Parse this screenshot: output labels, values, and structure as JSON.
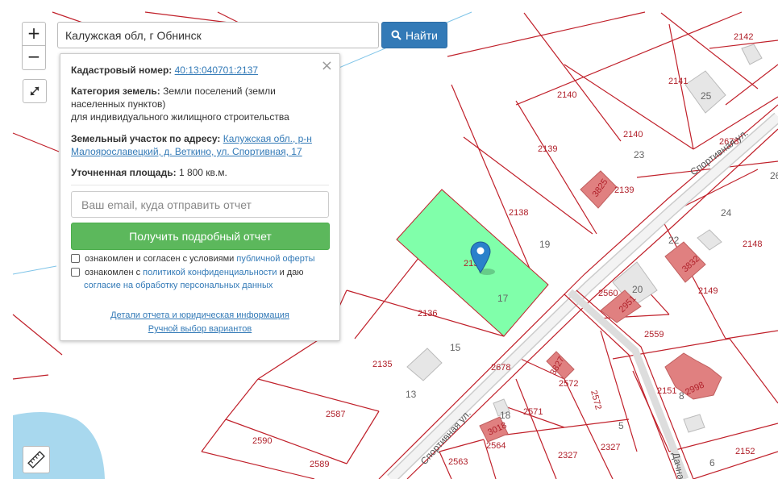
{
  "search": {
    "value": "Калужская обл, г Обнинск",
    "button_label": "Найти"
  },
  "zoom": {
    "in_label": "+",
    "out_label": "−"
  },
  "popup": {
    "close": "×",
    "cadastral_label": "Кадастровый номер:",
    "cadastral_number": "40:13:040701:2137",
    "category_label": "Категория земель:",
    "category_value_1": "Земли поселений (земли",
    "category_value_2": "населенных пунктов)",
    "category_value_3": "для индивидуального жилищного строительства",
    "address_label": "Земельный участок по адресу:",
    "address_part_1": "Калужская обл., р-н",
    "address_part_2": "Малоярославецкий, д. Веткино, ул. Спортивная, 17",
    "area_label": "Уточненная площадь:",
    "area_value": "1 800 кв.м.",
    "email_placeholder": "Ваш email, куда отправить отчет",
    "report_button": "Получить подробный отчет",
    "consent1_text": "ознакомлен и согласен с условиями",
    "consent1_link": "публичной оферты",
    "consent2_text": "ознакомлен с",
    "consent2_link1": "политикой конфиденциальности",
    "consent2_mid": "и даю",
    "consent2_link2": "согласие на обработку персональных данных",
    "details_link": "Детали отчета и юридическая информация",
    "manual_link": "Ручной выбор вариантов"
  },
  "map": {
    "selected_parcel_color": "#80ffaa",
    "parcel_border_color": "#c0202a",
    "building_color": "#e08080",
    "water_color": "#a8d8ee",
    "parcel_labels": {
      "p2142": "2142",
      "p2141": "2141",
      "p2140a": "2140",
      "p2140b": "2140",
      "p2139a": "2139",
      "p2139b": "2139",
      "p2138": "2138",
      "p2137": "2137",
      "p2136": "2136",
      "p2135": "2135",
      "p2678a": "2678",
      "p2678b": "2678",
      "p2148": "2148",
      "p2149": "2149",
      "p2560": "2560",
      "p2559": "2559",
      "p2572a": "2572",
      "p2572b": "2572",
      "p2571": "2571",
      "p2151": "2151",
      "p2587": "2587",
      "p2590": "2590",
      "p2589": "2589",
      "p2563": "2563",
      "p2564": "2564",
      "p2327a": "2327",
      "p2327b": "2327",
      "p2152": "2152"
    },
    "building_labels": {
      "b3832": "3832",
      "b2951": "2951",
      "b3827": "3827",
      "b2998": "2998",
      "b3018": "3018",
      "b3825": "3825"
    },
    "house_numbers": {
      "h25": "25",
      "h23": "23",
      "h24": "24",
      "h22": "22",
      "h26": "26",
      "h19": "19",
      "h17": "17",
      "h15": "15",
      "h13": "13",
      "h20": "20",
      "h18": "18",
      "h8": "8",
      "h5": "5",
      "h6": "6"
    },
    "streets": {
      "sport_top": "Спортивная ул.",
      "sport_bottom": "Спортивная ул.",
      "dachnaya": "Дачная"
    }
  }
}
